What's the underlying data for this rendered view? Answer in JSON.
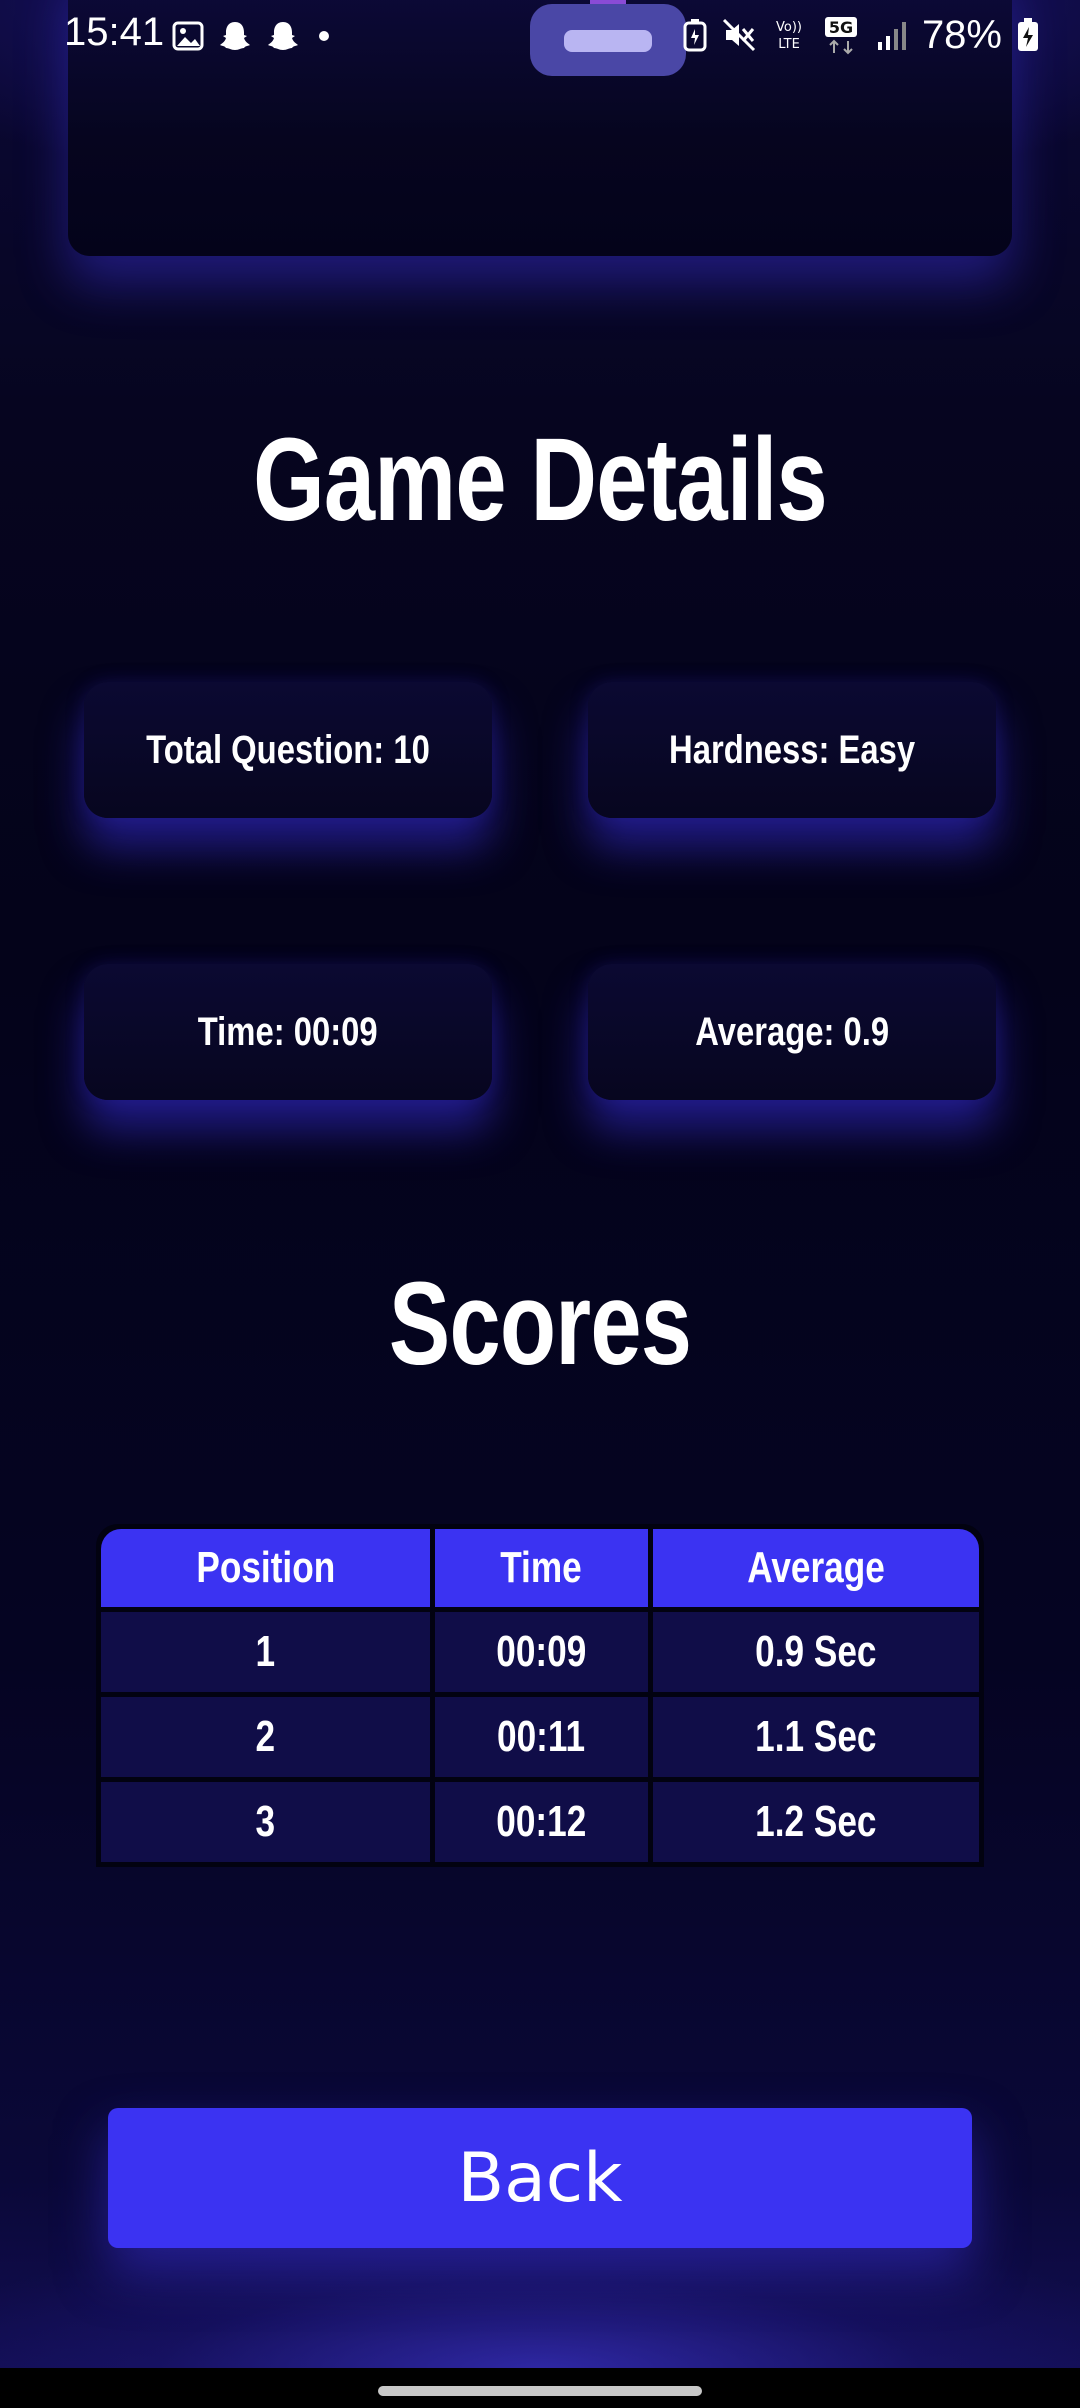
{
  "status_bar": {
    "time": "15:41",
    "battery": "78%",
    "left_icons": [
      "gallery-icon",
      "snapchat-icon",
      "snapchat-icon",
      "dot-icon"
    ],
    "right_icons": [
      "battery-saver-icon",
      "mute-icon",
      "volte-icon",
      "5g-icon",
      "signal-icon",
      "battery-charging-icon"
    ]
  },
  "game_details": {
    "title": "Game Details",
    "total_questions": "Total Question: 10",
    "hardness": "Hardness: Easy",
    "time": "Time: 00:09",
    "average": "Average: 0.9"
  },
  "scores": {
    "title": "Scores",
    "headers": [
      "Position",
      "Time",
      "Average"
    ],
    "rows": [
      [
        "1",
        "00:09",
        "0.9 Sec"
      ],
      [
        "2",
        "00:11",
        "1.1 Sec"
      ],
      [
        "3",
        "00:12",
        "1.2 Sec"
      ]
    ]
  },
  "back_label": "Back",
  "colors": {
    "accent": "#3b33f2",
    "background": "#04031a",
    "row_background": "#100d48",
    "text": "#ffffff"
  }
}
